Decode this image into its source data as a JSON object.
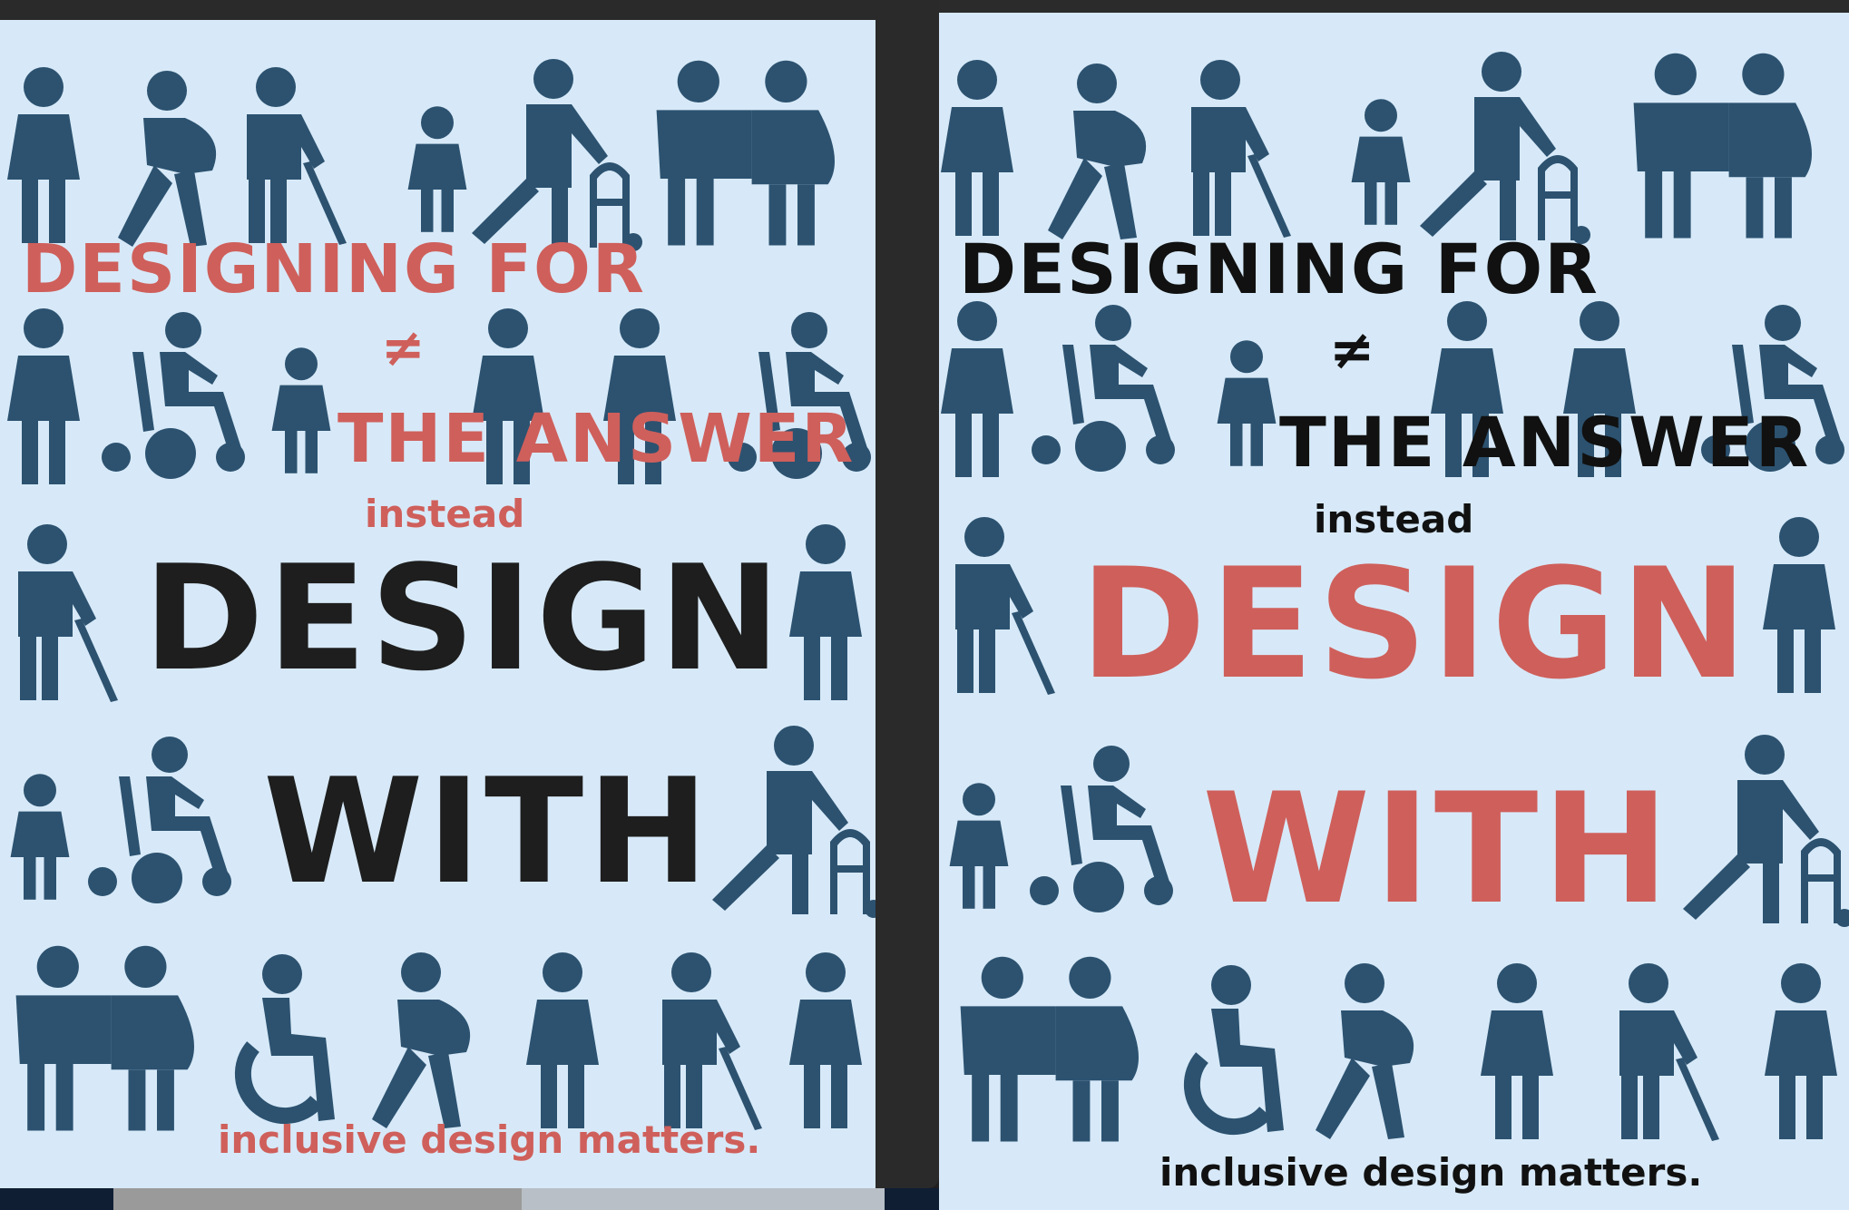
{
  "colors": {
    "figure": "#2c5270",
    "background": "#d7e9f8",
    "accent": "#cf5f5b",
    "black": "#1e1e1e",
    "window": "#2a2a2a"
  },
  "poster_left": {
    "line1": "DESIGNING FOR",
    "line2": "≠",
    "line3": "THE ANSWER",
    "instead": "instead",
    "design": "DESIGN",
    "with": "WITH",
    "footer": "inclusive design matters."
  },
  "poster_right": {
    "line1": "DESIGNING FOR",
    "line2": "≠",
    "line3": "THE ANSWER",
    "instead": "instead",
    "design": "DESIGN",
    "with": "WITH",
    "footer": "inclusive design matters."
  },
  "figures": [
    "adult",
    "pregnant-woman",
    "person-with-cane",
    "child",
    "person-with-walker",
    "couple",
    "person-in-wheelchair",
    "wheelchair-user-accessibility-symbol"
  ]
}
